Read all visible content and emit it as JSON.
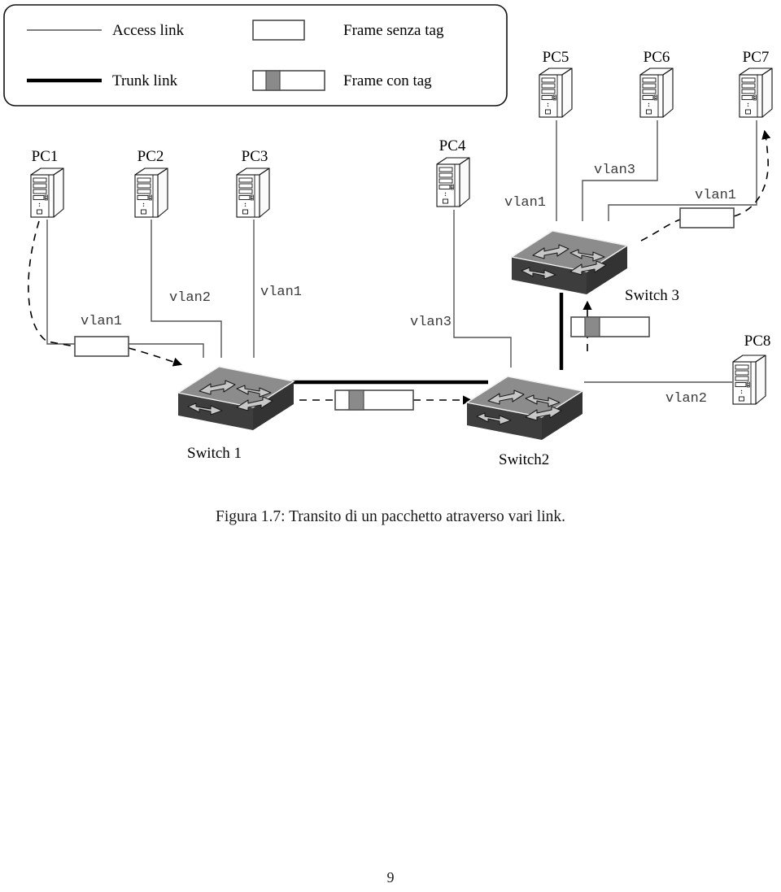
{
  "figure": {
    "caption": "Figura 1.7: Transito di un pacchetto atraverso vari link.",
    "page_number": "9"
  },
  "legend": {
    "items": [
      {
        "label": "Access link",
        "icon": "thin-line-icon"
      },
      {
        "label": "Trunk link",
        "icon": "thick-line-icon"
      },
      {
        "label": "Frame senza tag",
        "icon": "untagged-frame-icon"
      },
      {
        "label": "Frame con tag",
        "icon": "tagged-frame-icon"
      }
    ]
  },
  "nodes": {
    "hosts": [
      {
        "id": "pc1",
        "label": "PC1"
      },
      {
        "id": "pc2",
        "label": "PC2"
      },
      {
        "id": "pc3",
        "label": "PC3"
      },
      {
        "id": "pc4",
        "label": "PC4"
      },
      {
        "id": "pc5",
        "label": "PC5"
      },
      {
        "id": "pc6",
        "label": "PC6"
      },
      {
        "id": "pc7",
        "label": "PC7"
      },
      {
        "id": "pc8",
        "label": "PC8"
      }
    ],
    "switches": [
      {
        "id": "switch1",
        "label": "Switch 1"
      },
      {
        "id": "switch2",
        "label": "Switch2"
      },
      {
        "id": "switch3",
        "label": "Switch 3"
      }
    ]
  },
  "links": [
    {
      "from": "pc1",
      "to": "switch1",
      "vlan": "vlan1",
      "type": "access"
    },
    {
      "from": "pc2",
      "to": "switch1",
      "vlan": "vlan2",
      "type": "access"
    },
    {
      "from": "pc3",
      "to": "switch1",
      "vlan": "vlan1",
      "type": "access"
    },
    {
      "from": "pc4",
      "to": "switch2",
      "vlan": "vlan3",
      "type": "access"
    },
    {
      "from": "pc5",
      "to": "switch3",
      "vlan": "vlan1",
      "type": "access"
    },
    {
      "from": "pc6",
      "to": "switch3",
      "vlan": "vlan3",
      "type": "access"
    },
    {
      "from": "pc7",
      "to": "switch3",
      "vlan": "vlan1",
      "type": "access"
    },
    {
      "from": "pc8",
      "to": "switch2",
      "vlan": "vlan2",
      "type": "access"
    },
    {
      "from": "switch1",
      "to": "switch2",
      "vlan": "",
      "type": "trunk"
    },
    {
      "from": "switch2",
      "to": "switch3",
      "vlan": "",
      "type": "trunk"
    }
  ],
  "vlan_labels": {
    "pc1_link": "vlan1",
    "pc2_link": "vlan2",
    "pc3_link": "vlan1",
    "pc4_link": "vlan3",
    "pc5_link": "vlan1",
    "pc6_link": "vlan3",
    "pc7_link": "vlan1",
    "pc8_link": "vlan2"
  },
  "frames": [
    {
      "id": "frame-at-pc1",
      "tagged": false
    },
    {
      "id": "frame-on-trunk-1",
      "tagged": true
    },
    {
      "id": "frame-on-trunk-2",
      "tagged": true
    },
    {
      "id": "frame-at-pc7",
      "tagged": false
    }
  ],
  "colors": {
    "line": "#555555",
    "trunk": "#000000",
    "switch_top": "#8c8c8c",
    "switch_side": "#3d3d3d",
    "switch_arrow": "#c8c8c8",
    "frame_tag": "#8a8a8a",
    "frame_fill": "#ffffff",
    "text": "#000000",
    "mono_text": "#3a3a3a"
  }
}
